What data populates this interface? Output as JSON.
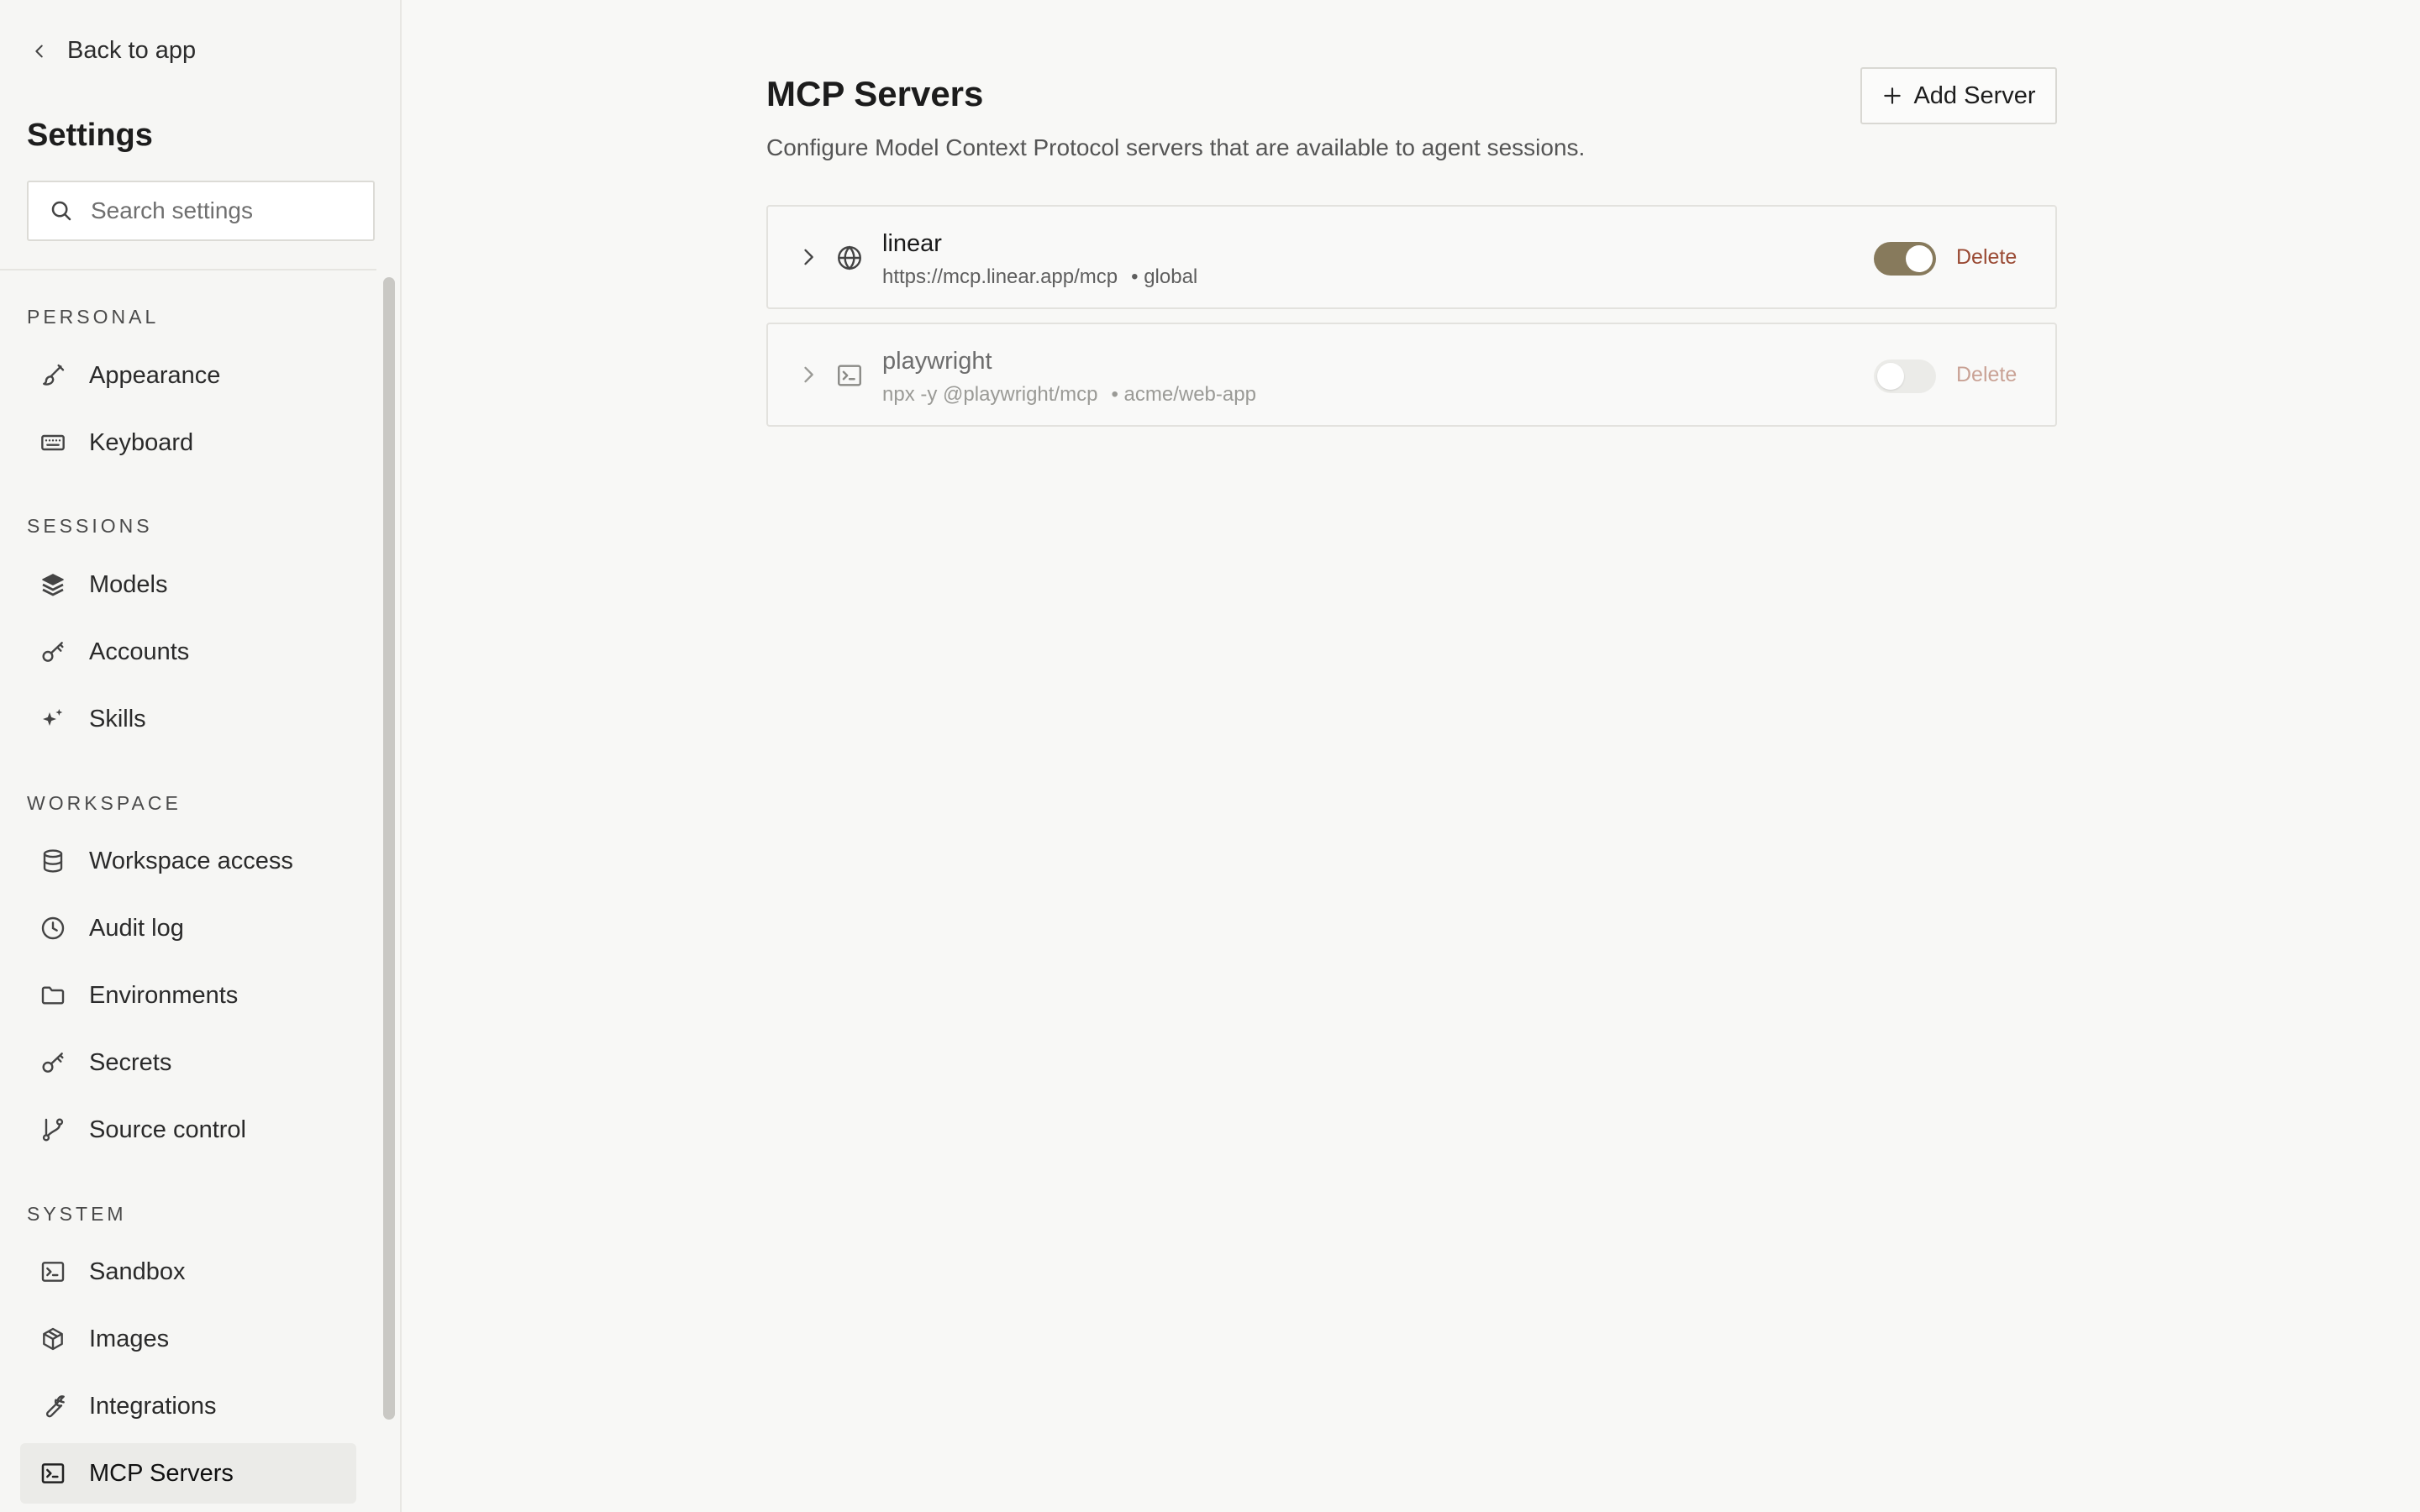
{
  "sidebar": {
    "back_label": "Back to app",
    "title": "Settings",
    "search_placeholder": "Search settings",
    "sections": {
      "personal": {
        "label": "PERSONAL",
        "items": [
          {
            "label": "Appearance",
            "icon": "brush-icon"
          },
          {
            "label": "Keyboard",
            "icon": "keyboard-icon"
          }
        ]
      },
      "sessions": {
        "label": "SESSIONS",
        "items": [
          {
            "label": "Models",
            "icon": "layers-icon"
          },
          {
            "label": "Accounts",
            "icon": "key-icon"
          },
          {
            "label": "Skills",
            "icon": "sparkles-icon"
          }
        ]
      },
      "workspace": {
        "label": "WORKSPACE",
        "items": [
          {
            "label": "Workspace access",
            "icon": "database-icon"
          },
          {
            "label": "Audit log",
            "icon": "clock-icon"
          },
          {
            "label": "Environments",
            "icon": "folder-icon"
          },
          {
            "label": "Secrets",
            "icon": "key-icon"
          },
          {
            "label": "Source control",
            "icon": "git-branch-icon"
          }
        ]
      },
      "system": {
        "label": "SYSTEM",
        "items": [
          {
            "label": "Sandbox",
            "icon": "terminal-icon"
          },
          {
            "label": "Images",
            "icon": "box-icon"
          },
          {
            "label": "Integrations",
            "icon": "wrench-icon"
          },
          {
            "label": "MCP Servers",
            "icon": "terminal-icon",
            "active": true
          }
        ]
      }
    }
  },
  "main": {
    "title": "MCP Servers",
    "description": "Configure Model Context Protocol servers that are available to agent sessions.",
    "add_button_label": "Add Server",
    "servers": [
      {
        "name": "linear",
        "target": "https://mcp.linear.app/mcp",
        "scope": "• global",
        "enabled": true,
        "icon": "globe-icon",
        "delete_label": "Delete"
      },
      {
        "name": "playwright",
        "target": "npx -y @playwright/mcp",
        "scope": "• acme/web-app",
        "enabled": false,
        "icon": "terminal-icon",
        "delete_label": "Delete"
      }
    ]
  },
  "colors": {
    "background": "#f8f8f6",
    "toggle_on": "#877a5c",
    "delete": "#9a4a34",
    "active_nav": "#ebebe8"
  }
}
